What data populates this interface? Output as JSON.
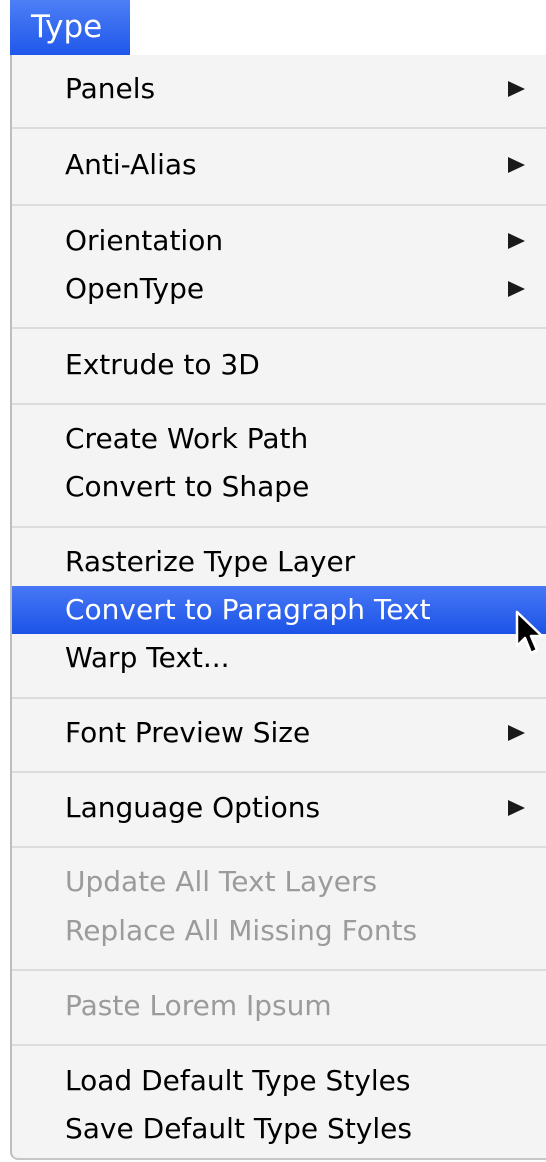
{
  "menu": {
    "title": "Type",
    "highlight_color": "#2b63f0",
    "items": [
      {
        "label": "Panels",
        "has_submenu": true,
        "enabled": true
      },
      {
        "label": "Anti-Alias",
        "has_submenu": true,
        "enabled": true
      },
      {
        "label": "Orientation",
        "has_submenu": true,
        "enabled": true
      },
      {
        "label": "OpenType",
        "has_submenu": true,
        "enabled": true
      },
      {
        "label": "Extrude to 3D",
        "has_submenu": false,
        "enabled": true
      },
      {
        "label": "Create Work Path",
        "has_submenu": false,
        "enabled": true
      },
      {
        "label": "Convert to Shape",
        "has_submenu": false,
        "enabled": true
      },
      {
        "label": "Rasterize Type Layer",
        "has_submenu": false,
        "enabled": true
      },
      {
        "label": "Convert to Paragraph Text",
        "has_submenu": false,
        "enabled": true,
        "highlighted": true
      },
      {
        "label": "Warp Text...",
        "has_submenu": false,
        "enabled": true
      },
      {
        "label": "Font Preview Size",
        "has_submenu": true,
        "enabled": true
      },
      {
        "label": "Language Options",
        "has_submenu": true,
        "enabled": true
      },
      {
        "label": "Update All Text Layers",
        "has_submenu": false,
        "enabled": false
      },
      {
        "label": "Replace All Missing Fonts",
        "has_submenu": false,
        "enabled": false
      },
      {
        "label": "Paste Lorem Ipsum",
        "has_submenu": false,
        "enabled": false
      },
      {
        "label": "Load Default Type Styles",
        "has_submenu": false,
        "enabled": true
      },
      {
        "label": "Save Default Type Styles",
        "has_submenu": false,
        "enabled": true
      }
    ]
  },
  "cursor": {
    "icon": "arrow-pointer-icon"
  }
}
